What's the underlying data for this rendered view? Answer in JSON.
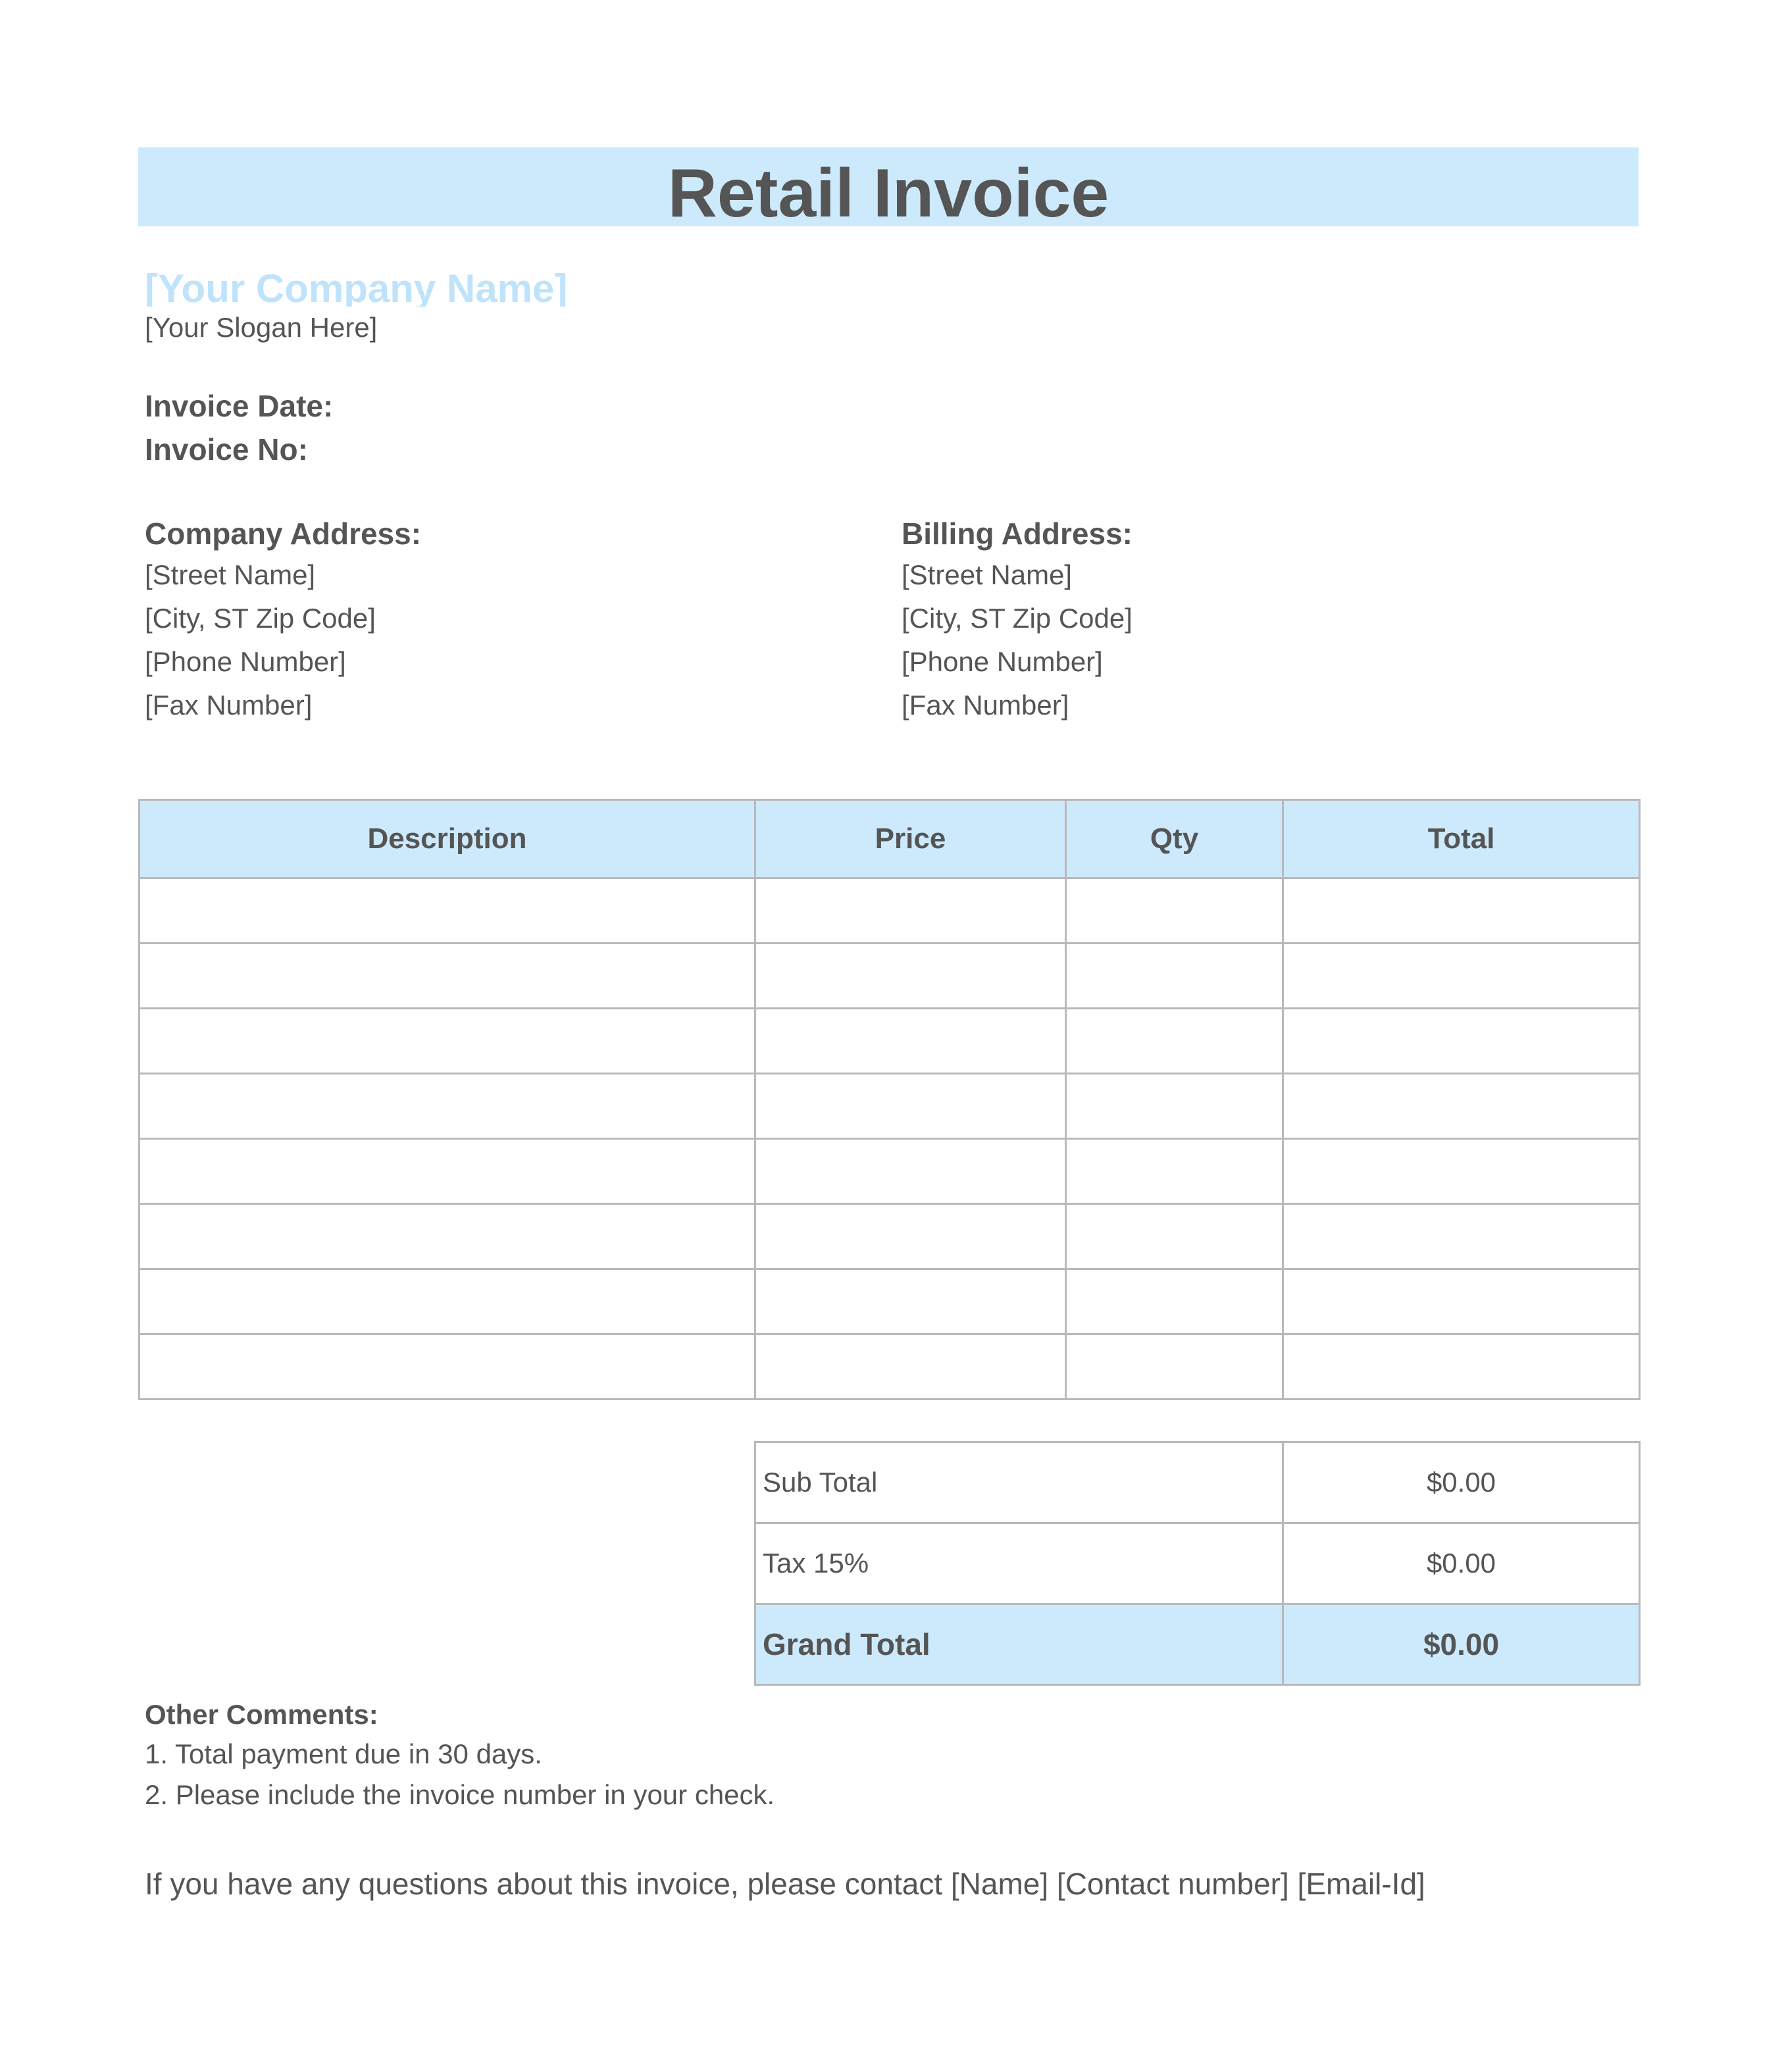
{
  "title": "Retail Invoice",
  "company": {
    "name": "[Your Company Name]",
    "slogan": "[Your Slogan Here]"
  },
  "meta": {
    "date_label": "Invoice Date:",
    "number_label": "Invoice No:"
  },
  "company_address": {
    "heading": "Company Address:",
    "lines": [
      "[Street Name]",
      "[City, ST Zip Code]",
      "[Phone Number]",
      "[Fax Number]"
    ]
  },
  "billing_address": {
    "heading": "Billing Address:",
    "lines": [
      "[Street Name]",
      "[City, ST Zip Code]",
      "[Phone Number]",
      "[Fax Number]"
    ]
  },
  "items_table": {
    "headers": [
      "Description",
      "Price",
      "Qty",
      "Total"
    ],
    "rows": [
      [
        "",
        "",
        "",
        ""
      ],
      [
        "",
        "",
        "",
        ""
      ],
      [
        "",
        "",
        "",
        ""
      ],
      [
        "",
        "",
        "",
        ""
      ],
      [
        "",
        "",
        "",
        ""
      ],
      [
        "",
        "",
        "",
        ""
      ],
      [
        "",
        "",
        "",
        ""
      ],
      [
        "",
        "",
        "",
        ""
      ]
    ]
  },
  "totals": {
    "subtotal_label": "Sub Total",
    "subtotal_value": "$0.00",
    "tax_label": "Tax 15%",
    "tax_value": "$0.00",
    "grand_label": "Grand Total",
    "grand_value": "$0.00"
  },
  "comments": {
    "heading": "Other Comments:",
    "items": [
      "1. Total payment due in 30 days.",
      "2. Please include the invoice number in your check."
    ]
  },
  "contact_line": "If you have any questions about this invoice, please contact [Name] [Contact number] [Email-Id]",
  "colors": {
    "header_fill": "#cdeafd",
    "company_name": "#bfe3fb",
    "text": "#555555",
    "border": "#b9b9b9"
  }
}
